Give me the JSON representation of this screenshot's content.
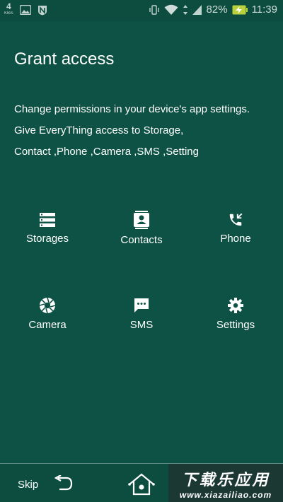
{
  "status_bar": {
    "net_speed": "4",
    "net_unit": "KB/s",
    "battery": "82%",
    "time": "11:39",
    "icons": [
      "photo-icon",
      "n-icon",
      "vibrate-icon",
      "wifi-icon",
      "data-arrows-icon",
      "signal-icon",
      "battery-charging-icon"
    ]
  },
  "page": {
    "title": "Grant access",
    "description": [
      "Change permissions in your device's app settings.",
      "Give EveryThing access to Storage,",
      "Contact ,Phone ,Camera ,SMS ,Setting"
    ]
  },
  "permissions": [
    {
      "label": "Storages",
      "icon": "storage-icon"
    },
    {
      "label": "Contacts",
      "icon": "contacts-icon"
    },
    {
      "label": "Phone",
      "icon": "phone-icon"
    },
    {
      "label": "Camera",
      "icon": "camera-icon"
    },
    {
      "label": "SMS",
      "icon": "sms-icon"
    },
    {
      "label": "Settings",
      "icon": "settings-icon"
    }
  ],
  "nav": {
    "skip_label": "Skip",
    "icons": [
      "back-icon",
      "home-icon"
    ]
  },
  "watermark": {
    "main": "下载乐应用",
    "sub": "www.xiazailiao.com"
  },
  "colors": {
    "background": "#0d5244",
    "text": "#ffffff"
  }
}
